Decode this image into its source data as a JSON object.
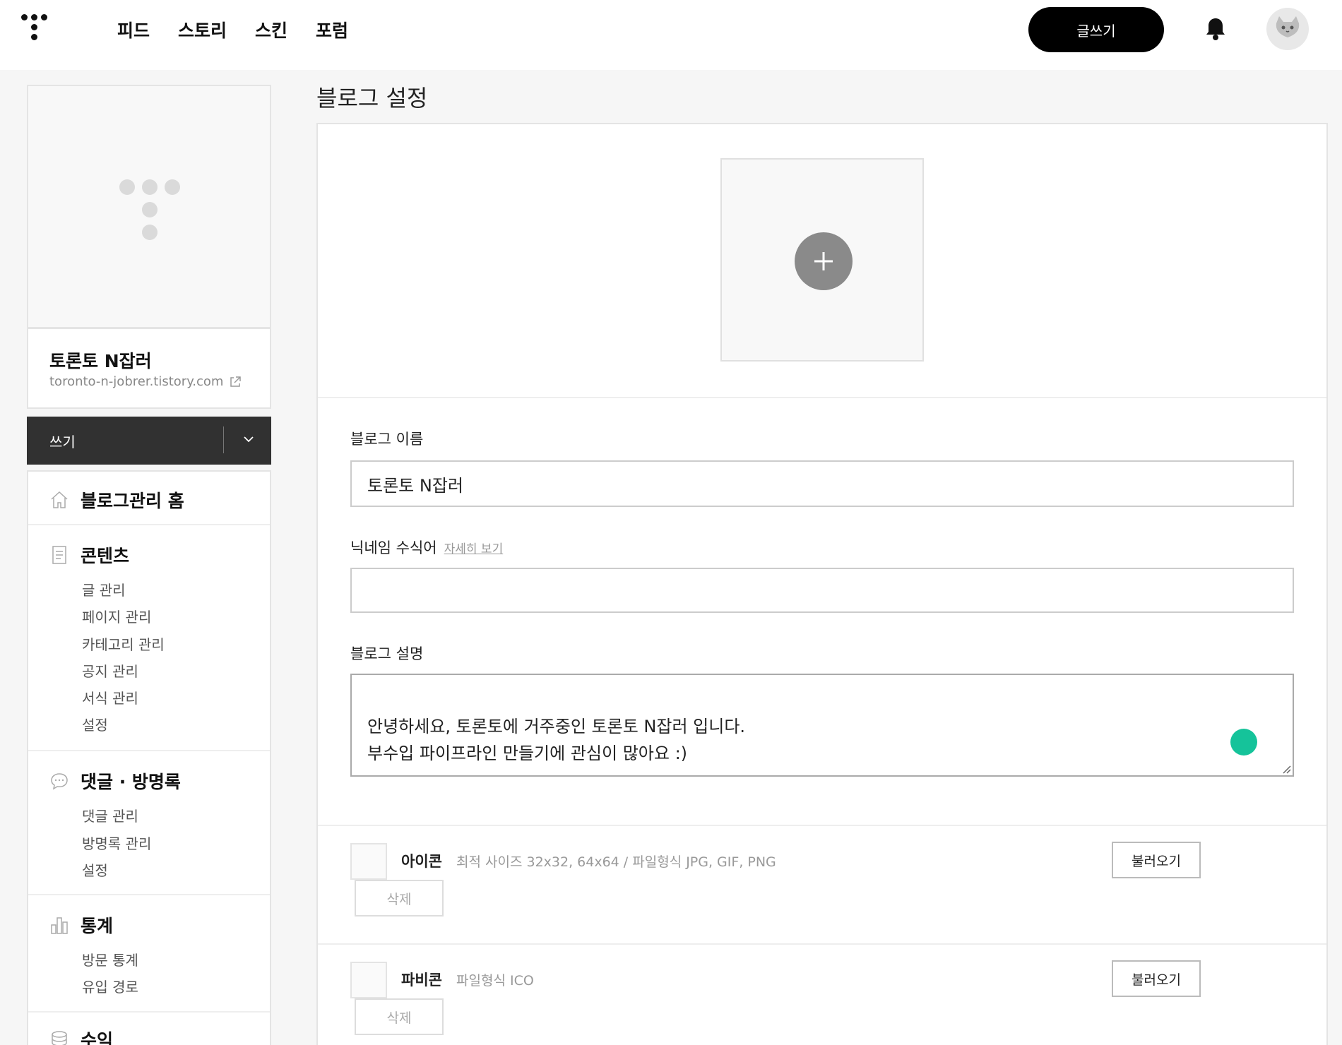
{
  "header": {
    "nav": [
      "피드",
      "스토리",
      "스킨",
      "포럼"
    ],
    "write_button": "글쓰기"
  },
  "sidebar": {
    "blog_title": "토론토 N잡러",
    "blog_url": "toronto-n-jobrer.tistory.com",
    "write_menu": "쓰기",
    "home": "블로그관리 홈",
    "sections": [
      {
        "title": "콘텐츠",
        "items": [
          "글 관리",
          "페이지 관리",
          "카테고리 관리",
          "공지 관리",
          "서식 관리",
          "설정"
        ]
      },
      {
        "title": "댓글 · 방명록",
        "items": [
          "댓글 관리",
          "방명록 관리",
          "설정"
        ]
      },
      {
        "title": "통계",
        "items": [
          "방문 통계",
          "유입 경로"
        ]
      },
      {
        "title": "수익",
        "items": []
      }
    ]
  },
  "main": {
    "page_title": "블로그 설정",
    "blog_name_label": "블로그 이름",
    "blog_name_value": "토론토 N잡러",
    "nickname_label": "닉네임 수식어",
    "nickname_link": "자세히 보기",
    "nickname_value": "",
    "description_label": "블로그 설명",
    "description_value": "안녕하세요, 토론토에 거주중인 토론토 N잡러 입니다.\n부수입 파이프라인 만들기에 관심이 많아요 :)",
    "icon": {
      "name": "아이콘",
      "hint": "최적 사이즈 32x32, 64x64 / 파일형식 JPG, GIF, PNG",
      "load": "불러오기",
      "delete": "삭제"
    },
    "favicon": {
      "name": "파비콘",
      "hint": "파일형식 ICO",
      "load": "불러오기",
      "delete": "삭제"
    }
  }
}
